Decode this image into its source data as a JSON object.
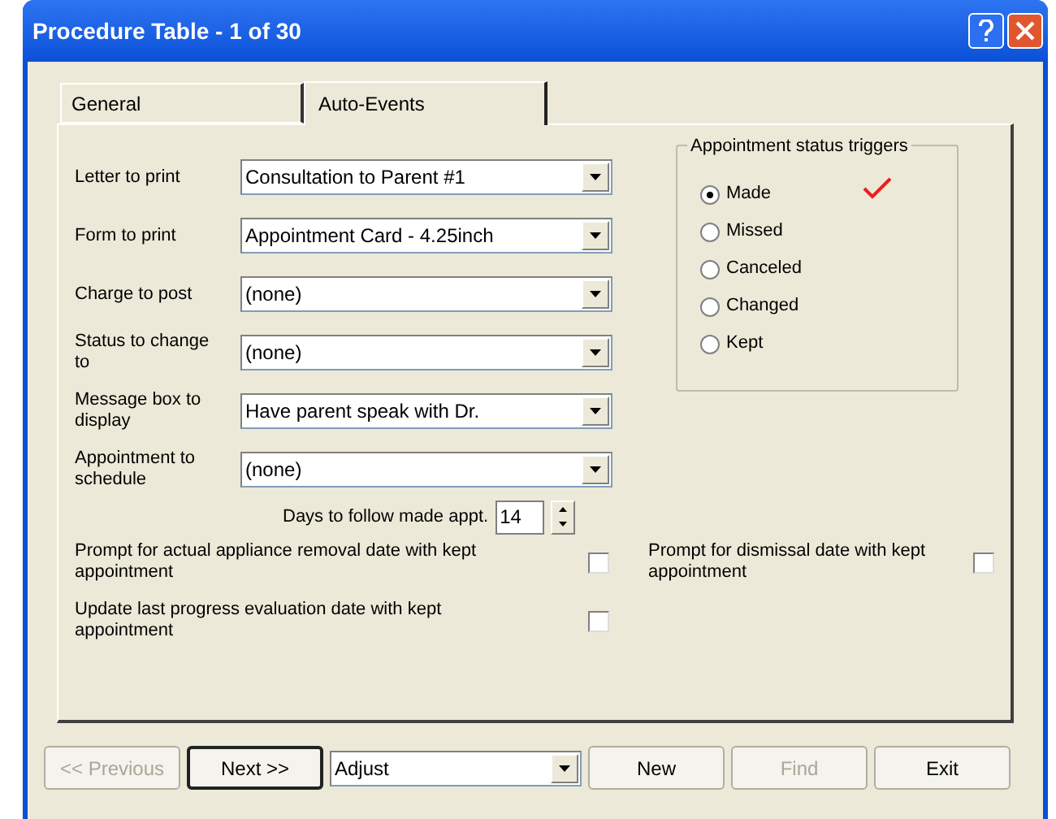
{
  "window": {
    "title": "Procedure Table - 1 of 30"
  },
  "tabs": [
    {
      "label": "General",
      "selected": false
    },
    {
      "label": "Auto-Events",
      "selected": true
    }
  ],
  "fields": [
    {
      "label": "Letter to print",
      "value": "Consultation to Parent #1"
    },
    {
      "label": "Form to print",
      "value": "Appointment Card - 4.25inch"
    },
    {
      "label": "Charge to post",
      "value": "(none)"
    },
    {
      "label": "Status to change to",
      "value": "(none)"
    },
    {
      "label": "Message box to display",
      "value": "Have parent speak with Dr."
    },
    {
      "label": "Appointment to schedule",
      "value": "(none)"
    }
  ],
  "days": {
    "label": "Days to follow made appt.",
    "value": "14"
  },
  "status_triggers": {
    "title": "Appointment status triggers",
    "options": [
      {
        "label": "Made",
        "selected": true
      },
      {
        "label": "Missed",
        "selected": false
      },
      {
        "label": "Canceled",
        "selected": false
      },
      {
        "label": "Changed",
        "selected": false
      },
      {
        "label": "Kept",
        "selected": false
      }
    ]
  },
  "left_checkboxes": [
    {
      "label": "Prompt for actual appliance removal date with kept appointment",
      "checked": false
    },
    {
      "label": "Update last progress evaluation date with kept appointment",
      "checked": false
    }
  ],
  "right_checkboxes": [
    {
      "label": "Prompt for dismissal date with kept appointment",
      "checked": false
    }
  ],
  "footer": [
    {
      "kind": "button",
      "label": "<< Previous",
      "disabled": true,
      "default": false
    },
    {
      "kind": "button",
      "label": "Next >>",
      "disabled": false,
      "default": true
    },
    {
      "kind": "combo",
      "value": "Adjust"
    },
    {
      "kind": "button",
      "label": "New",
      "disabled": false,
      "default": false
    },
    {
      "kind": "button",
      "label": "Find",
      "disabled": true,
      "default": false
    },
    {
      "kind": "button",
      "label": "Exit",
      "disabled": false,
      "default": false
    }
  ]
}
